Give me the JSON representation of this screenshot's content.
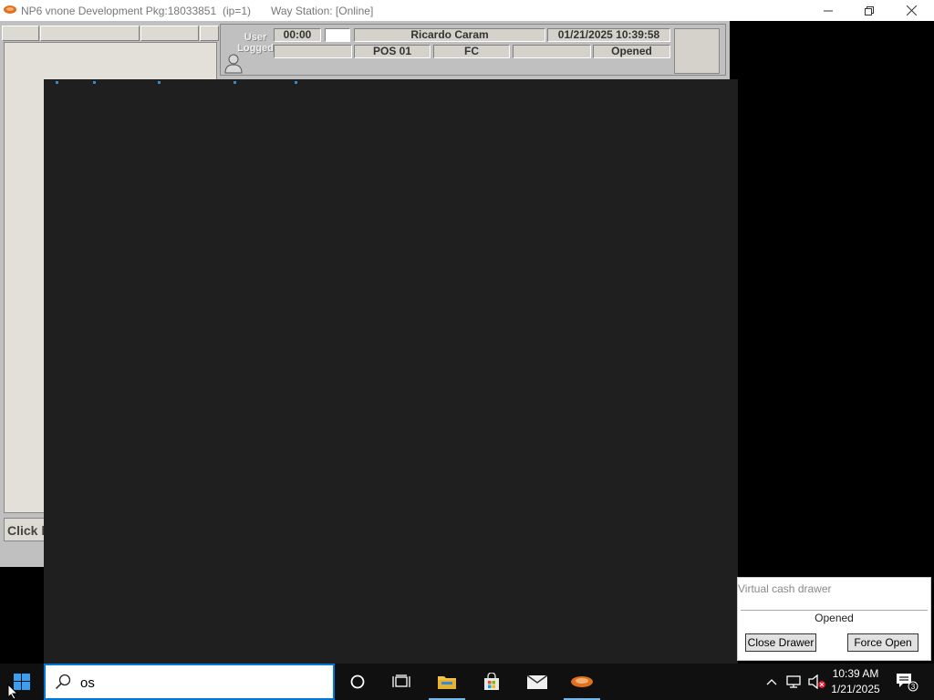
{
  "window": {
    "title": "NP6 vnone Development Pkg:18033851",
    "ip": "(ip=1)",
    "way_station": "Way Station: [Online]"
  },
  "status_panel": {
    "user_logged_line1": "User",
    "user_logged_line2": "Logged",
    "timer": "00:00",
    "user_name": "Ricardo Caram",
    "datetime": "01/21/2025 10:39:58",
    "pos": "POS 01",
    "mode": "FC",
    "drawer_state": "Opened"
  },
  "left_panel": {
    "click_here": "Click h"
  },
  "cash_drawer": {
    "title": "Virtual cash drawer",
    "status": "Opened",
    "close_button": "Close Drawer",
    "force_open_button": "Force Open"
  },
  "taskbar": {
    "search_value": "os",
    "clock_time": "10:39 AM",
    "clock_date": "1/21/2025",
    "notification_count": "3"
  },
  "colors": {
    "accent": "#0078d7",
    "app_gray": "#c0c0c0",
    "overlay": "#1f1f1f"
  }
}
